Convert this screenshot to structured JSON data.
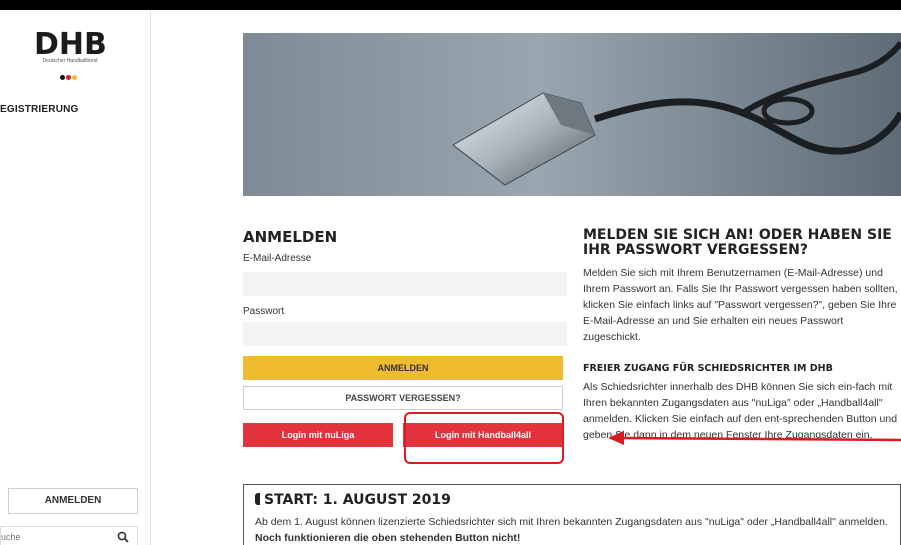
{
  "sidebar": {
    "logo_text": "DHB",
    "logo_subtitle": "Deutscher Handballbund",
    "nav_registration": "EGISTRIERUNG",
    "login_button": "ANMELDEN",
    "search_placeholder": "uche"
  },
  "login": {
    "heading": "ANMELDEN",
    "email_label": "E-Mail-Adresse",
    "email_value": "",
    "password_label": "Passwort",
    "password_value": "",
    "submit_label": "ANMELDEN",
    "forgot_label": "PASSWORT VERGESSEN?",
    "nuliga_label": "Login mit nuLiga",
    "handball4all_label": "Login mit Handball4all"
  },
  "info": {
    "heading": "MELDEN SIE SICH AN! ODER HABEN SIE IHR PASSWORT VERGESSEN?",
    "paragraph": "Melden Sie sich mit Ihrem Benutzernamen (E-Mail-Adresse) und Ihrem Passwort an. Falls Sie Ihr Passwort vergessen haben sollten, klicken Sie einfach links auf \"Passwort vergessen?\", geben Sie Ihre E-Mail-Adresse an und Sie erhalten ein neues Passwort zugeschickt.",
    "referee_heading": "FREIER ZUGANG FÜR SCHIEDSRICHTER IM DHB",
    "referee_paragraph": "Als Schiedsrichter innerhalb des DHB können Sie sich ein-fach mit Ihren bekannten Zugangsdaten aus \"nuLiga\" oder „Handball4all\" anmelden. Klicken Sie einfach auf den ent-sprechenden Button und geben Sie dann in dem neuen Fenster Ihre Zugangsdaten ein."
  },
  "start": {
    "heading": "START: 1. AUGUST 2019",
    "text": "Ab dem 1. August können lizenzierte Schiedsrichter sich mit Ihren bekannten Zugangsdaten aus \"nuLiga\" oder „Handball4all\" anmelden.",
    "bold_text": "Noch funktionieren die oben stehenden Button nicht!"
  },
  "colors": {
    "accent_yellow": "#f0bc2f",
    "accent_red": "#e2323b",
    "annotation_red": "#d91b22"
  },
  "icons": {
    "search": "search-icon",
    "whistle": "whistle-image",
    "arrow": "annotation-arrow-icon"
  }
}
